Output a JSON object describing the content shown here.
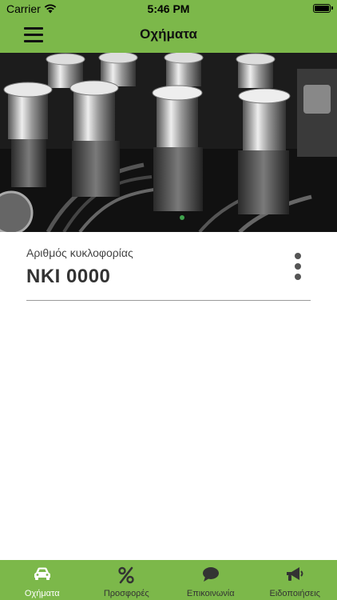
{
  "status_bar": {
    "carrier": "Carrier",
    "time": "5:46 PM"
  },
  "navbar": {
    "title": "Οχήματα",
    "menu_icon": "hamburger-menu-icon"
  },
  "hero": {
    "image": "engine-carburetors-photo"
  },
  "vehicle": {
    "plate_label": "Αριθμός κυκλοφορίας",
    "plate_number": "NKI 0000",
    "more_icon": "vertical-dots-icon"
  },
  "tabs": [
    {
      "label": "Οχήματα",
      "icon": "car-icon",
      "active": true
    },
    {
      "label": "Προσφορές",
      "icon": "percent-icon",
      "active": false
    },
    {
      "label": "Επικοινωνία",
      "icon": "chat-bubble-icon",
      "active": false
    },
    {
      "label": "Ειδοποιήσεις",
      "icon": "megaphone-icon",
      "active": false
    }
  ],
  "colors": {
    "primary": "#7cb84a",
    "active_tab": "#ffffff",
    "inactive_tab": "#333333"
  }
}
